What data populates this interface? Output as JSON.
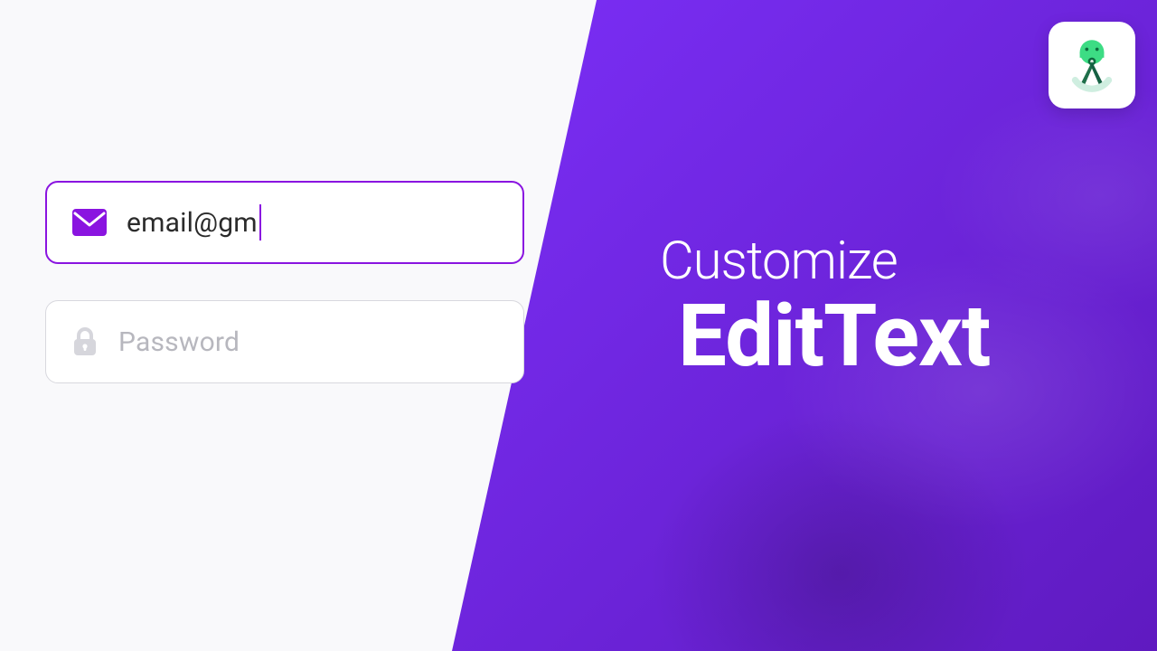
{
  "colors": {
    "accent": "#8a14e0",
    "panel_gradient_from": "#7b2ff7",
    "panel_gradient_to": "#5f1ac0",
    "placeholder": "#b7b7be",
    "field_border_inactive": "#d8d8de",
    "page_bg": "#f9f9fb"
  },
  "badge": {
    "icon": "android-studio-icon"
  },
  "title": {
    "line1": "Customize",
    "line2": "EditText"
  },
  "form": {
    "email": {
      "icon": "mail-icon",
      "value": "email@gm",
      "focused": true
    },
    "password": {
      "icon": "lock-icon",
      "placeholder": "Password",
      "value": "",
      "focused": false
    }
  }
}
